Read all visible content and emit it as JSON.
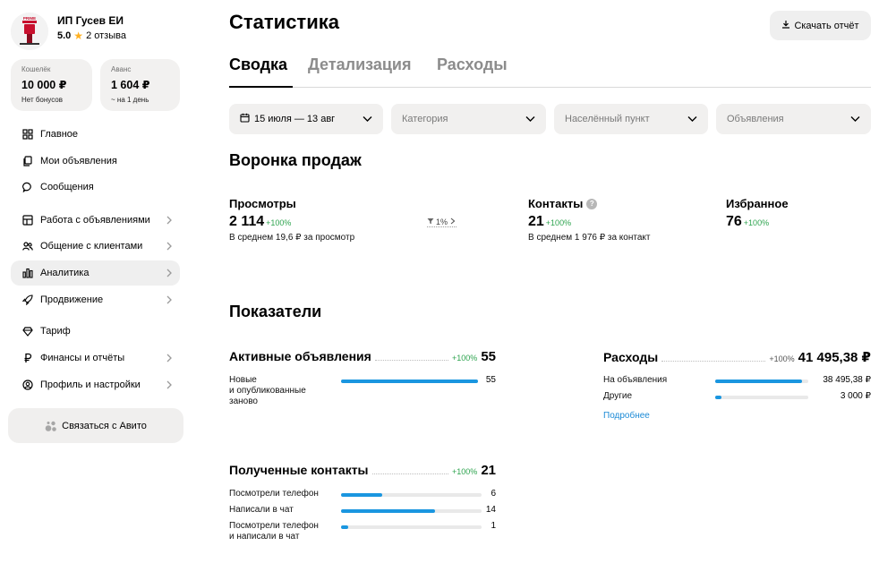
{
  "profile": {
    "name": "ИП Гусев ЕИ",
    "rating": "5.0",
    "reviews": "2 отзыва",
    "avatar_text": "PRIME"
  },
  "wallet": {
    "label": "Кошелёк",
    "value": "10 000 ₽",
    "sub": "Нет бонусов"
  },
  "advance": {
    "label": "Аванс",
    "value": "1 604 ₽",
    "sub": "~ на 1 день"
  },
  "nav": [
    {
      "label": "Главное",
      "icon": "grid-icon",
      "chevron": false
    },
    {
      "label": "Мои объявления",
      "icon": "copy-icon",
      "chevron": false
    },
    {
      "label": "Сообщения",
      "icon": "chat-icon",
      "chevron": false
    },
    {
      "label": "Работа с объявлениями",
      "icon": "layout-icon",
      "chevron": true
    },
    {
      "label": "Общение с клиентами",
      "icon": "users-icon",
      "chevron": true
    },
    {
      "label": "Аналитика",
      "icon": "bar-chart-icon",
      "chevron": true,
      "active": true
    },
    {
      "label": "Продвижение",
      "icon": "rocket-icon",
      "chevron": true
    },
    {
      "label": "Тариф",
      "icon": "diamond-icon",
      "chevron": false
    },
    {
      "label": "Финансы и отчёты",
      "icon": "ruble-icon",
      "chevron": true
    },
    {
      "label": "Профиль и настройки",
      "icon": "user-circle-icon",
      "chevron": true
    }
  ],
  "contact_button": "Связаться с Авито",
  "page": {
    "title": "Статистика",
    "download": "Скачать отчёт"
  },
  "tabs": [
    "Сводка",
    "Детализация",
    "Расходы"
  ],
  "filters": {
    "date": "15 июля — 13 авг",
    "category": "Категория",
    "city": "Населённый пункт",
    "ads": "Объявления"
  },
  "funnel": {
    "title": "Воронка продаж",
    "views": {
      "label": "Просмотры",
      "value": "2 114",
      "delta": "+100%",
      "sub": "В среднем 19,6 ₽ за просмотр"
    },
    "conversion": "1%",
    "contacts": {
      "label": "Контакты",
      "value": "21",
      "delta": "+100%",
      "sub": "В среднем 1 976 ₽ за контакт"
    },
    "favorites": {
      "label": "Избранное",
      "value": "76",
      "delta": "+100%"
    }
  },
  "indicators": {
    "title": "Показатели",
    "active_ads": {
      "title": "Активные объявления",
      "delta": "+100%",
      "value": "55",
      "rows": [
        {
          "label": "Новые\nи опубликованные\nзаново",
          "value": "55",
          "fill": 1.0
        }
      ]
    },
    "expenses": {
      "title": "Расходы",
      "delta": "+100%",
      "value": "41 495,38 ₽",
      "rows": [
        {
          "label": "На объявления",
          "value": "38 495,38 ₽",
          "fill": 0.93
        },
        {
          "label": "Другие",
          "value": "3 000 ₽",
          "fill": 0.07
        }
      ],
      "more": "Подробнее"
    },
    "contacts": {
      "title": "Полученные контакты",
      "delta": "+100%",
      "value": "21",
      "rows": [
        {
          "label": "Посмотрели телефон",
          "value": "6",
          "fill": 0.29
        },
        {
          "label": "Написали в чат",
          "value": "14",
          "fill": 0.67
        },
        {
          "label": "Посмотрели телефон\nи написали в чат",
          "value": "1",
          "fill": 0.05
        }
      ]
    }
  },
  "colors": {
    "accent_blue": "#1a96e0",
    "positive_green": "#2ea44f",
    "link_blue": "#1b8ad6",
    "star": "#ffb021"
  }
}
